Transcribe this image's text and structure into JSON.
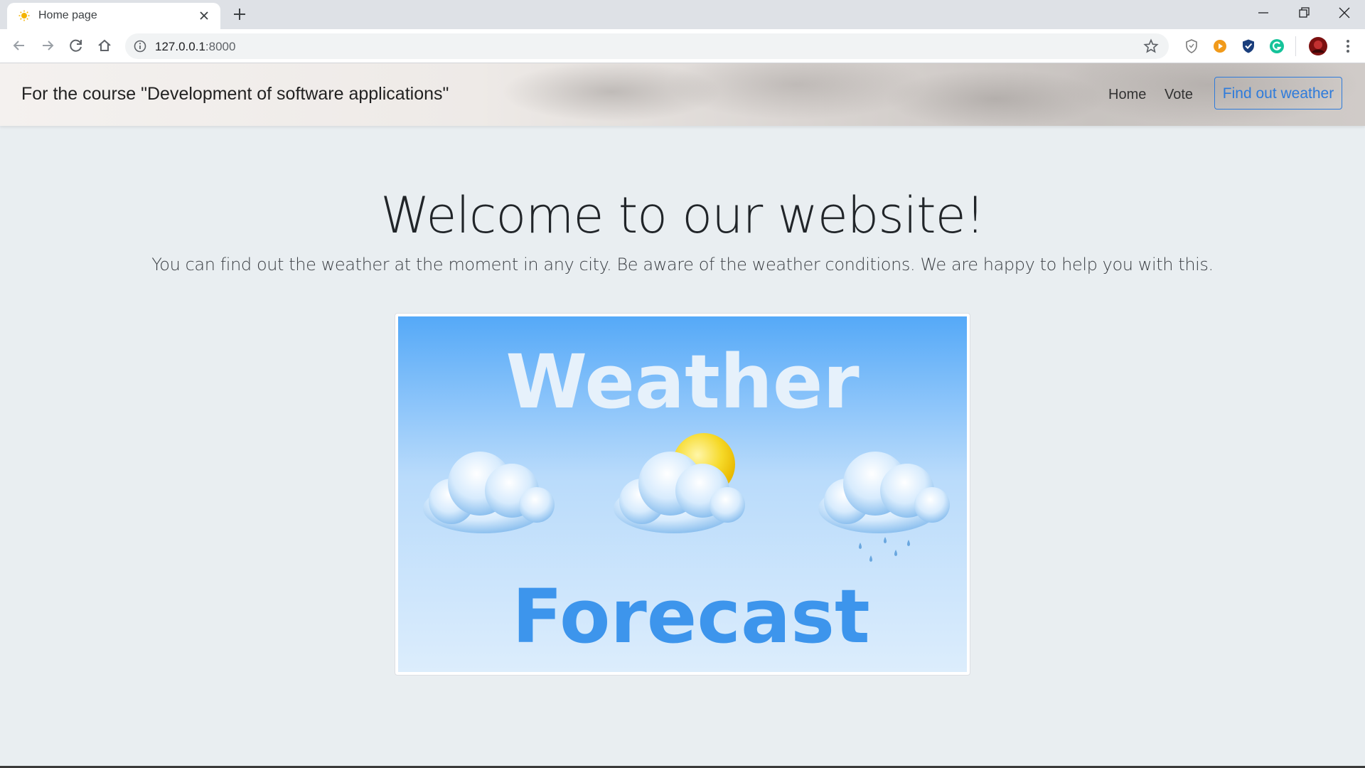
{
  "browser": {
    "tab_title": "Home page",
    "url_host": "127.0.0.1",
    "url_port": ":8000",
    "icons": [
      "sun-favicon-icon",
      "close-icon",
      "plus-icon",
      "minimize-icon",
      "restore-icon",
      "close-window-icon",
      "back-icon",
      "forward-icon",
      "reload-icon",
      "home-icon",
      "info-icon",
      "star-icon",
      "shield-extension-icon",
      "play-extension-icon",
      "shield-check-extension-icon",
      "grammarly-extension-icon",
      "profile-avatar-icon",
      "menu-dots-icon"
    ]
  },
  "navbar": {
    "brand": "For the course \"Development of software applications\"",
    "links": [
      "Home",
      "Vote"
    ],
    "button": "Find out weather"
  },
  "hero": {
    "title": "Welcome to our website!",
    "subtitle": "You can find out the weather at the moment in any city. Be aware of the weather conditions. We are happy to help you with this."
  },
  "image": {
    "word_top": "Weather",
    "word_bottom": "Forecast"
  },
  "colors": {
    "accent": "#2e7bdb",
    "page_bg": "#e9eef1",
    "sky_top": "#55a9f8",
    "sky_bottom": "#dcedfc",
    "forecast_text": "#3d95ec"
  }
}
